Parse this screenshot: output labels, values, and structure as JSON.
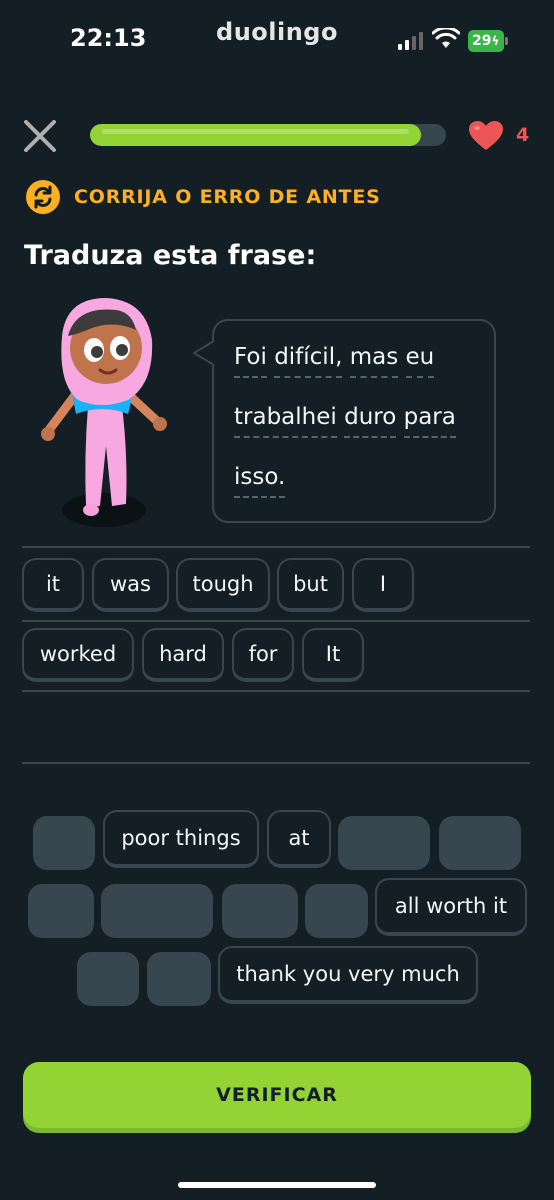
{
  "status_bar": {
    "time": "22:13",
    "app_name": "duolingo",
    "battery": "29"
  },
  "lesson": {
    "progress_percent": 93,
    "hearts": "4",
    "banner": "CORRIJA O ERRO DE ANTES",
    "prompt": "Traduza esta frase:"
  },
  "sentence": {
    "line1": [
      "Foi",
      "difícil,",
      "mas",
      "eu"
    ],
    "line2": [
      "trabalhei",
      "duro",
      "para"
    ],
    "line3": [
      "isso."
    ]
  },
  "answer_tiles": [
    "it",
    "was",
    "tough",
    "but",
    "I",
    "worked",
    "hard",
    "for",
    "It"
  ],
  "word_bank": [
    {
      "label": "",
      "used": true
    },
    {
      "label": "poor things",
      "used": false
    },
    {
      "label": "at",
      "used": false
    },
    {
      "label": "",
      "used": true
    },
    {
      "label": "",
      "used": true
    },
    {
      "label": "",
      "used": true
    },
    {
      "label": "",
      "used": true
    },
    {
      "label": "",
      "used": true
    },
    {
      "label": "",
      "used": true
    },
    {
      "label": "all worth it",
      "used": false
    },
    {
      "label": "",
      "used": true
    },
    {
      "label": "",
      "used": true
    },
    {
      "label": "thank you very much",
      "used": false
    }
  ],
  "verify_label": "VERIFICAR",
  "colors": {
    "background": "#131f24",
    "accent_green": "#93d333",
    "banner_orange": "#ffb020",
    "heart_red": "#ee5555",
    "border": "#37464f"
  }
}
